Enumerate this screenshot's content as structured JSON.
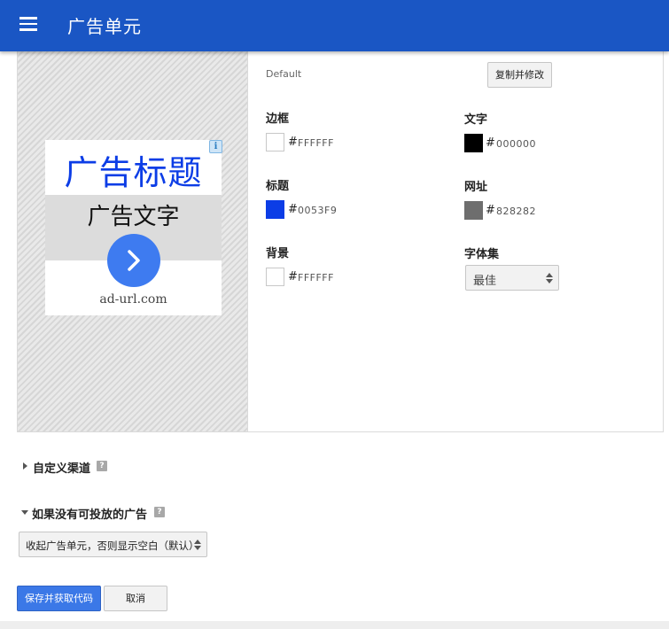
{
  "header": {
    "title": "广告单元",
    "menu_icon": "hamburger-menu-icon",
    "background_color": "#1a56c4"
  },
  "preview": {
    "ad_title": "广告标题",
    "ad_text": "广告文字",
    "ad_url": "ad-url.com",
    "info_glyph": "i",
    "title_color": "#0053F9",
    "button_color": "#3e7bf0"
  },
  "style": {
    "current_style": "Default",
    "copy_button": "复制并修改"
  },
  "colors": {
    "border": {
      "label": "边框",
      "hash": "#",
      "value": "FFFFFF",
      "swatch": "#FFFFFF"
    },
    "text": {
      "label": "文字",
      "hash": "#",
      "value": "000000",
      "swatch": "#000000"
    },
    "title": {
      "label": "标题",
      "hash": "#",
      "value": "0053F9",
      "swatch": "#0053F9"
    },
    "url": {
      "label": "网址",
      "hash": "#",
      "value": "828282",
      "swatch": "#828282"
    },
    "background": {
      "label": "背景",
      "hash": "#",
      "value": "FFFFFF",
      "swatch": "#FFFFFF"
    }
  },
  "font_family": {
    "label": "字体集",
    "selected": "最佳"
  },
  "custom_channels": {
    "label": "自定义渠道",
    "help_glyph": "?"
  },
  "no_ads": {
    "label": "如果没有可投放的广告",
    "help_glyph": "?",
    "selected": "收起广告单元，否则显示空白（默认）"
  },
  "actions": {
    "save": "保存并获取代码",
    "cancel": "取消",
    "save_color": "#3b78e7"
  }
}
